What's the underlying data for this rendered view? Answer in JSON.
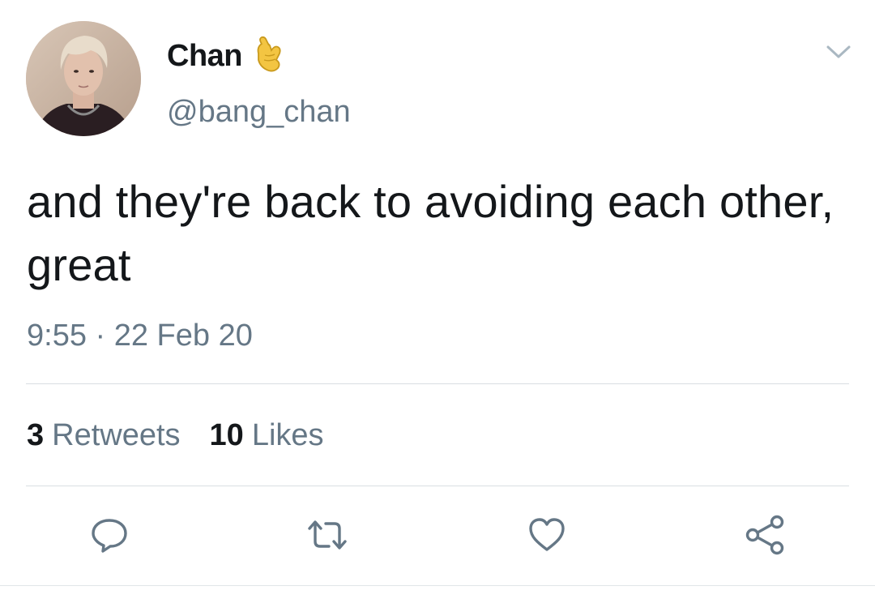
{
  "author": {
    "display_name": "Chan",
    "handle": "@bang_chan",
    "name_emoji": "call-me-hand-emoji"
  },
  "tweet": {
    "text": "and they're back to avoiding each other, great",
    "timestamp": "9:55 · 22 Feb 20"
  },
  "stats": {
    "retweets_count": "3",
    "retweets_label": "Retweets",
    "likes_count": "10",
    "likes_label": "Likes"
  },
  "actions": {
    "reply_icon": "reply-icon",
    "retweet_icon": "retweet-icon",
    "like_icon": "heart-icon",
    "share_icon": "share-icon"
  },
  "colors": {
    "text": "#14171a",
    "secondary": "#657786",
    "divider": "#d9dee2"
  }
}
